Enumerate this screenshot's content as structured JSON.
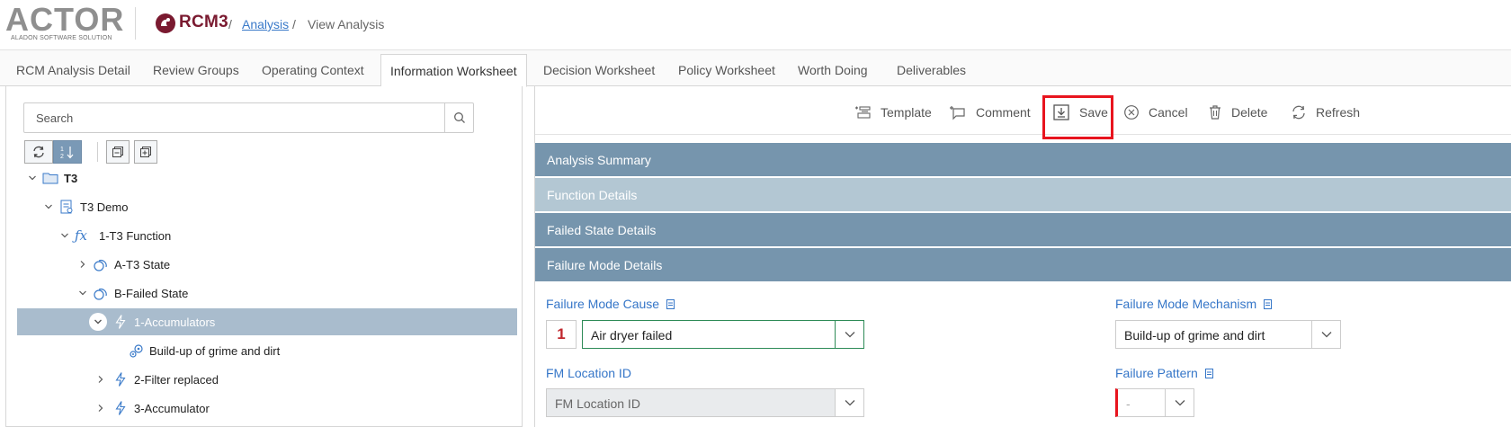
{
  "header": {
    "logo_main": "ACTOR",
    "logo_sub": "ALADON SOFTWARE SOLUTION",
    "product": "RCM3",
    "breadcrumb": {
      "link": "Analysis",
      "separator": "/",
      "current": "View Analysis"
    }
  },
  "tabs": [
    {
      "label": "RCM Analysis Detail"
    },
    {
      "label": "Review Groups"
    },
    {
      "label": "Operating Context"
    },
    {
      "label": "Information Worksheet",
      "active": true
    },
    {
      "label": "Decision Worksheet"
    },
    {
      "label": "Policy Worksheet"
    },
    {
      "label": "Worth Doing"
    },
    {
      "label": "Deliverables"
    }
  ],
  "left": {
    "search": {
      "placeholder": "Search"
    },
    "tree": [
      {
        "label": "T3",
        "icon": "folder-icon",
        "expanded": true
      },
      {
        "label": "T3 Demo",
        "icon": "document-icon",
        "expanded": true
      },
      {
        "label": "1-T3 Function",
        "icon": "function-icon",
        "expanded": true
      },
      {
        "label": "A-T3 State",
        "icon": "state-icon",
        "expanded": false
      },
      {
        "label": "B-Failed State",
        "icon": "state-icon",
        "expanded": true
      },
      {
        "label": "1-Accumulators",
        "icon": "lightning-icon",
        "expanded": true,
        "selected": true
      },
      {
        "label": "Build-up of grime and dirt",
        "icon": "mechanism-icon"
      },
      {
        "label": "2-Filter replaced",
        "icon": "lightning-icon",
        "expanded": false
      },
      {
        "label": "3-Accumulator",
        "icon": "lightning-icon",
        "expanded": false
      }
    ]
  },
  "toolbar": {
    "template": "Template",
    "comment": "Comment",
    "save": "Save",
    "cancel": "Cancel",
    "delete": "Delete",
    "refresh": "Refresh"
  },
  "sections": {
    "analysis_summary": "Analysis Summary",
    "function_details": "Function Details",
    "failed_state_details": "Failed State Details",
    "failure_mode_details": "Failure Mode Details"
  },
  "form": {
    "failure_mode_cause": {
      "label": "Failure Mode Cause",
      "number": "1",
      "value": "Air dryer failed"
    },
    "failure_mode_mechanism": {
      "label": "Failure Mode Mechanism",
      "value": "Build-up of grime and dirt"
    },
    "fm_location_id": {
      "label": "FM Location ID",
      "value": "FM Location ID"
    },
    "failure_pattern": {
      "label": "Failure Pattern",
      "value": "-"
    }
  },
  "colors": {
    "section_bar": "#7695ad",
    "section_bar_light": "#b3c7d3",
    "link_blue": "#3576c8",
    "highlight_red": "#e8141e",
    "tree_selected": "#a9bccd"
  }
}
